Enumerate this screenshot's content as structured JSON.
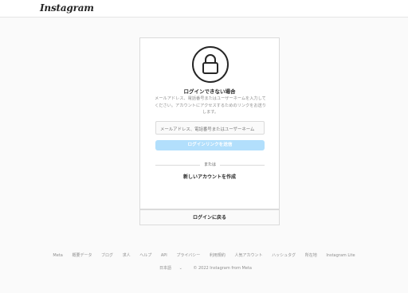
{
  "header": {
    "logo_text": "Instagram"
  },
  "card": {
    "icon": "lock-icon",
    "title": "ログインできない場合",
    "description": "メールアドレス、電話番号またはユーザーネームを入力してください。アカウントにアクセスするためのリンクをお送りします。",
    "input_placeholder": "メールアドレス、電話番号またはユーザーネーム",
    "submit_label": "ログインリンクを送信",
    "or_text": "または",
    "create_account_label": "新しいアカウントを作成",
    "back_to_login_label": "ログインに戻る"
  },
  "footer": {
    "links": [
      "Meta",
      "概要データ",
      "ブログ",
      "求人",
      "ヘルプ",
      "API",
      "プライバシー",
      "利用規約",
      "人気アカウント",
      "ハッシュタグ",
      "所在地",
      "Instagram Lite"
    ],
    "language": "日本語",
    "copyright": "© 2022 Instagram from Meta"
  },
  "colors": {
    "button_disabled": "#b2dffc",
    "border": "#dbdbdb",
    "muted_text": "#8e8e8e"
  }
}
